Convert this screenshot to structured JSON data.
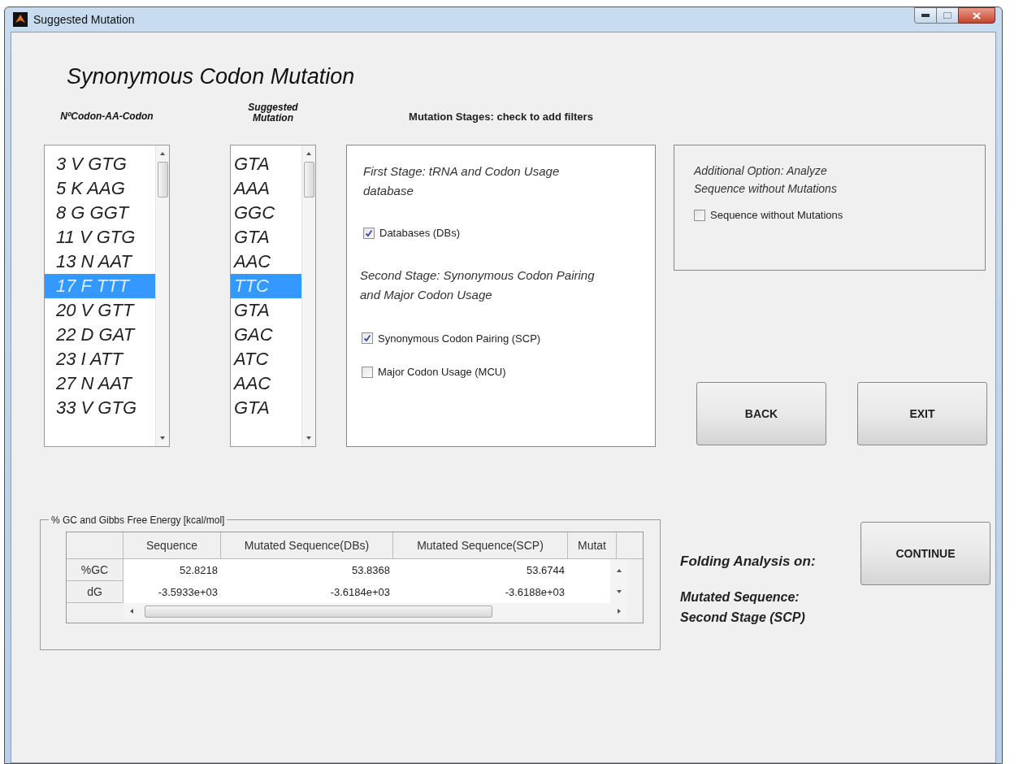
{
  "window": {
    "title": "Suggested Mutation"
  },
  "heading": "Synonymous Codon Mutation",
  "codon_list": {
    "header": "NºCodon-AA-Codon",
    "items": [
      {
        "text": "3 V GTG",
        "selected": false
      },
      {
        "text": "5 K AAG",
        "selected": false
      },
      {
        "text": "8 G GGT",
        "selected": false
      },
      {
        "text": "11 V GTG",
        "selected": false
      },
      {
        "text": "13 N AAT",
        "selected": false
      },
      {
        "text": "17 F TTT",
        "selected": true
      },
      {
        "text": "20 V GTT",
        "selected": false
      },
      {
        "text": "22 D GAT",
        "selected": false
      },
      {
        "text": "23 I ATT",
        "selected": false
      },
      {
        "text": "27 N AAT",
        "selected": false
      },
      {
        "text": "33 V GTG",
        "selected": false
      }
    ]
  },
  "mutation_list": {
    "header": "Suggested Mutation",
    "items": [
      {
        "text": "GTA",
        "selected": false
      },
      {
        "text": "AAA",
        "selected": false
      },
      {
        "text": "GGC",
        "selected": false
      },
      {
        "text": "GTA",
        "selected": false
      },
      {
        "text": "AAC",
        "selected": false
      },
      {
        "text": "TTC",
        "selected": true
      },
      {
        "text": "GTA",
        "selected": false
      },
      {
        "text": "GAC",
        "selected": false
      },
      {
        "text": "ATC",
        "selected": false
      },
      {
        "text": "AAC",
        "selected": false
      },
      {
        "text": "GTA",
        "selected": false
      }
    ]
  },
  "stages": {
    "header": "Mutation Stages: check to add filters",
    "items": [
      {
        "kind": "note",
        "text": "First Stage: tRNA and Codon Usage database"
      },
      {
        "kind": "checkbox",
        "text": "Databases (DBs)",
        "checked": true
      },
      {
        "kind": "note",
        "text": "Second Stage: Synonymous Codon Pairing and Major Codon Usage"
      },
      {
        "kind": "checkbox",
        "text": "Synonymous Codon Pairing (SCP)",
        "checked": true
      },
      {
        "kind": "checkbox",
        "text": "Major Codon Usage (MCU)",
        "checked": false
      }
    ]
  },
  "additional": {
    "note": "Additional Option: Analyze Sequence without Mutations",
    "checkbox": {
      "text": "Sequence without Mutations",
      "checked": false
    }
  },
  "buttons": [
    "BACK",
    "EXIT"
  ],
  "energy_group": {
    "title": "% GC and Gibbs Free Energy [kcal/mol]",
    "columns": [
      "Sequence",
      "Mutated Sequence(DBs)",
      "Mutated Sequence(SCP)",
      "Mutat"
    ],
    "rows": [
      {
        "label": "%GC",
        "cells": [
          "52.8218",
          "53.8368",
          "53.6744"
        ]
      },
      {
        "label": "dG",
        "cells": [
          "-3.5933e+03",
          "-3.6184e+03",
          "-3.6188e+03"
        ]
      }
    ]
  },
  "folding": {
    "label": "Folding Analysis on:",
    "target": "Mutated Sequence: Second Stage (SCP)",
    "button": "CONTINUE"
  }
}
